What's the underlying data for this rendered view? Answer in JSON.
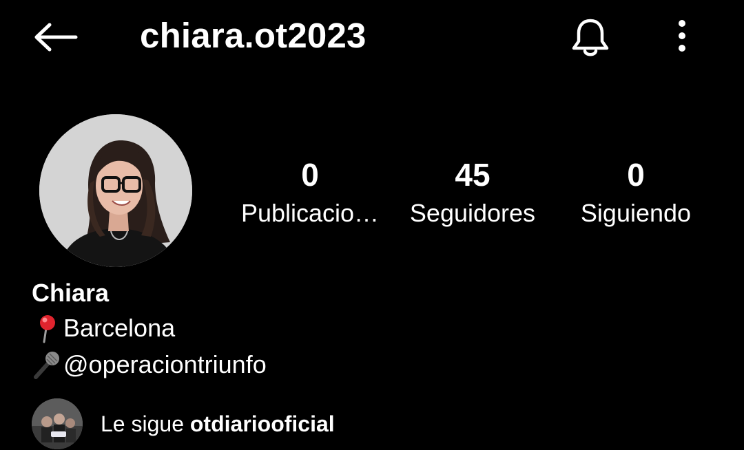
{
  "header": {
    "username": "chiara.ot2023",
    "back_icon": "arrow-left-icon",
    "notification_icon": "bell-icon",
    "menu_icon": "more-vertical-icon"
  },
  "stats": {
    "posts": {
      "value": "0",
      "label": "Publicacio…"
    },
    "followers": {
      "value": "45",
      "label": "Seguidores"
    },
    "following": {
      "value": "0",
      "label": "Siguiendo"
    }
  },
  "profile": {
    "display_name": "Chiara",
    "bio": [
      {
        "icon": "round-pushpin-icon",
        "text": "Barcelona"
      },
      {
        "icon": "microphone-icon",
        "text": "@operaciontriunfo"
      }
    ]
  },
  "followed_by": {
    "prefix": "Le sigue ",
    "account": "otdiariooficial"
  },
  "colors": {
    "background": "#000000",
    "text": "#ffffff",
    "pin_red": "#e0242e"
  }
}
